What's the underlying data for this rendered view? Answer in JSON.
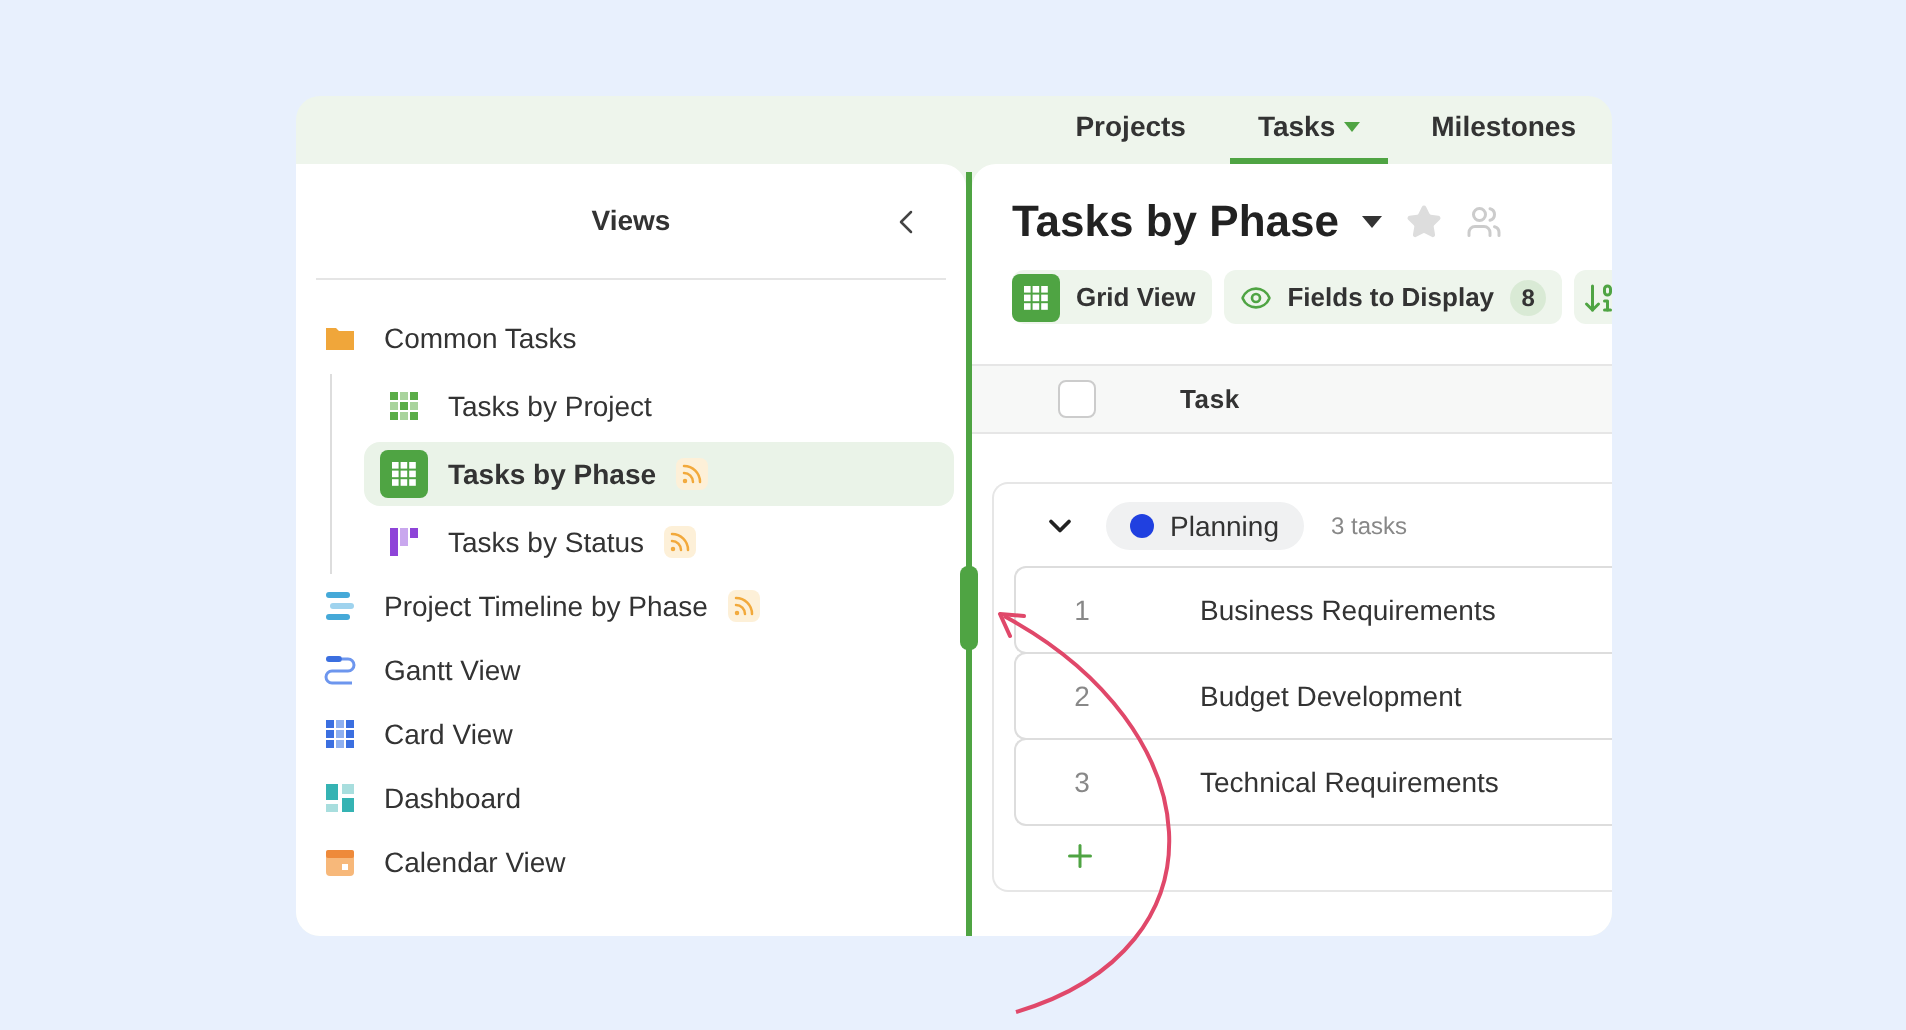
{
  "top_tabs": [
    {
      "label": "Projects",
      "selected": false,
      "dropdown": false
    },
    {
      "label": "Tasks",
      "selected": true,
      "dropdown": true
    },
    {
      "label": "Milestones",
      "selected": false,
      "dropdown": false
    }
  ],
  "sidebar": {
    "title": "Views",
    "items": [
      {
        "label": "Common Tasks",
        "kind": "folder",
        "selected": false,
        "feed": false,
        "children": [
          {
            "label": "Tasks by Project",
            "kind": "grid-light",
            "selected": false,
            "feed": false
          },
          {
            "label": "Tasks by Phase",
            "kind": "grid",
            "selected": true,
            "feed": true
          },
          {
            "label": "Tasks by Status",
            "kind": "kanban",
            "selected": false,
            "feed": true
          }
        ]
      },
      {
        "label": "Project Timeline by Phase",
        "kind": "timeline",
        "selected": false,
        "feed": true
      },
      {
        "label": "Gantt View",
        "kind": "gantt",
        "selected": false,
        "feed": false
      },
      {
        "label": "Card View",
        "kind": "cards",
        "selected": false,
        "feed": false
      },
      {
        "label": "Dashboard",
        "kind": "dashboard",
        "selected": false,
        "feed": false
      },
      {
        "label": "Calendar View",
        "kind": "calendar",
        "selected": false,
        "feed": false
      }
    ]
  },
  "view": {
    "title": "Tasks by Phase",
    "toolbar": [
      {
        "kind": "grid",
        "label": "Grid View"
      },
      {
        "kind": "fields",
        "label": "Fields to Display",
        "count": "8"
      },
      {
        "kind": "sort"
      }
    ],
    "table": {
      "select_all": {
        "checked": false
      },
      "columns": [
        "Task"
      ],
      "groups": [
        {
          "label": "Planning",
          "color": "#2040e0",
          "count": "3 tasks",
          "expanded": true,
          "rows": [
            {
              "number": "1",
              "task": "Business Requirements"
            },
            {
              "number": "2",
              "task": "Budget Development"
            },
            {
              "number": "3",
              "task": "Technical Requirements"
            }
          ]
        }
      ]
    }
  }
}
